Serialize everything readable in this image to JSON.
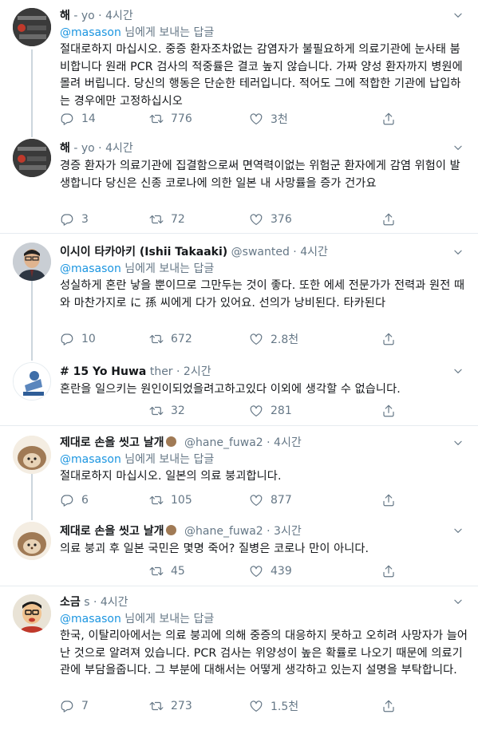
{
  "reply_prefix": "님에게 보내는 답글",
  "tweets": [
    {
      "name": "해",
      "handle": "yo",
      "time": "4시간",
      "mention": "@masason",
      "text": "절대로하지 마십시오. 중증 환자조차없는 감염자가 불필요하게 의료기관에 눈사태 붐비합니다 원래 PCR 검사의 적중률은 결코 높지 않습니다. 가짜 양성 환자까지 병원에 몰려 버립니다. 당신의 행동은 단순한 테러입니다. 적어도 그에 적합한 기관에 납입하는 경우에만 고정하십시오",
      "replies": "14",
      "retweets": "776",
      "likes": "3천"
    },
    {
      "name": "해",
      "handle": "yo",
      "time": "4시간",
      "mention": "",
      "text": "경증 환자가 의료기관에 집결함으로써 면역력이없는 위험군 환자에게 감염 위험이 발생합니다 당신은 신종 코로나에 의한 일본 내 사망률을 증가 건가요",
      "replies": "3",
      "retweets": "72",
      "likes": "376"
    },
    {
      "name": "이시이 타카아키 (Ishii Takaaki)",
      "handle": "@swanted",
      "time": "4시간",
      "mention": "@masason",
      "text": "성실하게 혼란 낳을 뿐이므로 그만두는 것이 좋다. 또한 에세 전문가가 전력과 원전 때와 마찬가지로 に 孫 씨에게 다가 있어요. 선의가 낭비된다. 타카된다",
      "replies": "10",
      "retweets": "672",
      "likes": "2.8천"
    },
    {
      "name": "# 15 Yo Huwa",
      "handle": "ther",
      "time": "2시간",
      "mention": "",
      "text": "혼란을 일으키는 원인이되었을려고하고있다 이외에 생각할 수 없습니다.",
      "replies": "",
      "retweets": "32",
      "likes": "281"
    },
    {
      "name": "제대로 손을 씻고 날개",
      "handle": "@hane_fuwa2",
      "time": "4시간",
      "mention": "@masason",
      "text": "절대로하지 마십시오. 일본의 의료 붕괴합니다.",
      "replies": "6",
      "retweets": "105",
      "likes": "877"
    },
    {
      "name": "제대로 손을 씻고 날개",
      "handle": "@hane_fuwa2",
      "time": "3시간",
      "mention": "",
      "text": "의료 붕괴 후 일본 국민은 몇명 죽어? 질병은 코로나 만이 아니다.",
      "replies": "",
      "retweets": "45",
      "likes": "439"
    },
    {
      "name": "소금",
      "handle": "s",
      "time": "4시간",
      "mention": "@masason",
      "text": "한국, 이탈리아에서는 의료 붕괴에 의해 중증의 대응하지 못하고 오히려 사망자가 늘어난 것으로 알려져 있습니다. PCR 검사는 위양성이 높은 확률로 나오기 때문에 의료기관에 부담을줍니다. 그 부분에 대해서는 어떻게 생각하고 있는지 설명을 부탁합니다.",
      "replies": "7",
      "retweets": "273",
      "likes": "1.5천"
    }
  ],
  "colors": {
    "text": "#14171a",
    "muted": "#657786",
    "link": "#1b95e0",
    "border": "#e6ecf0"
  },
  "icons": [
    "chevron-down-icon",
    "reply-icon",
    "retweet-icon",
    "like-icon",
    "share-icon",
    "hedgehog-emoji"
  ]
}
